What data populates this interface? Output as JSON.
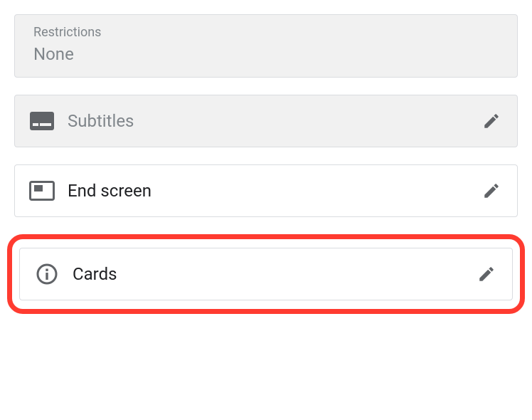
{
  "restrictions": {
    "label": "Restrictions",
    "value": "None"
  },
  "rows": {
    "subtitles": {
      "label": "Subtitles"
    },
    "endScreen": {
      "label": "End screen"
    },
    "cards": {
      "label": "Cards"
    }
  }
}
